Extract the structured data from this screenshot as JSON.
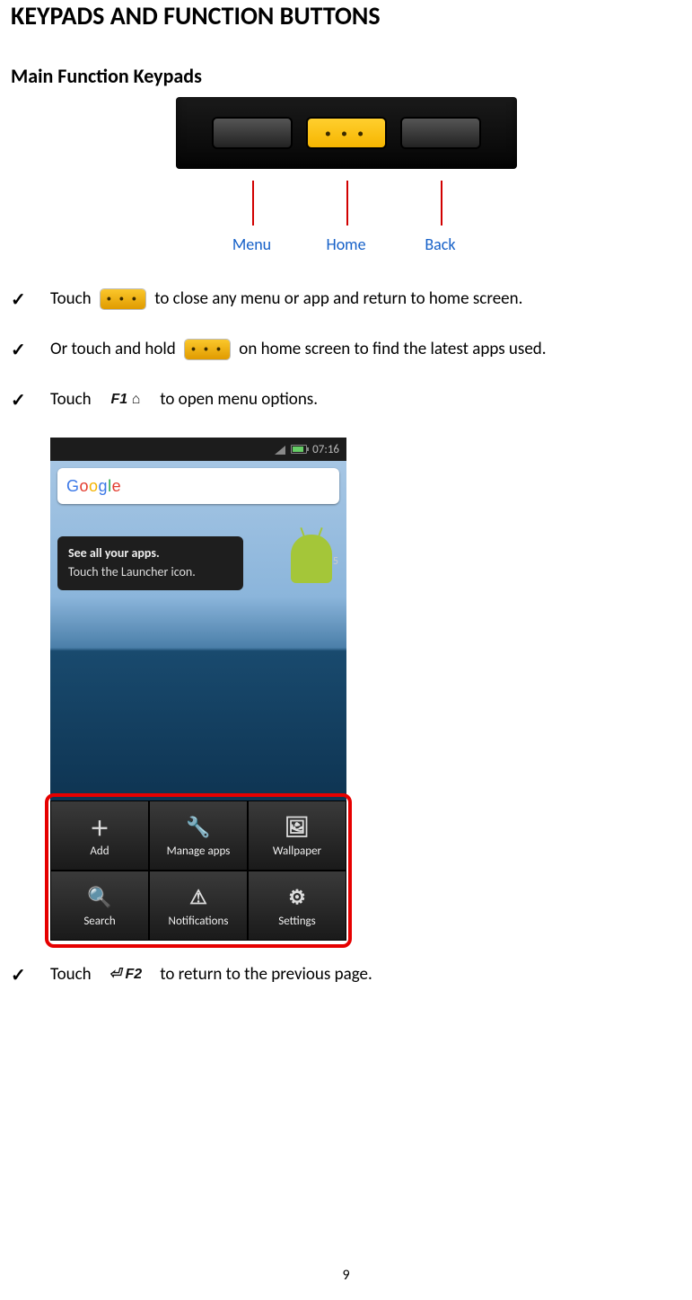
{
  "title_pre": "K",
  "title_mid1": "EYPADS AND ",
  "title_cap2": "F",
  "title_mid2": "UNCTION ",
  "title_cap3": "B",
  "title_mid3": "UTTONS",
  "subtitle": "Main Function Keypads",
  "keypad_labels": {
    "menu": "Menu",
    "home": "Home",
    "back": "Back"
  },
  "bullets": {
    "b1_a": "Touch",
    "b1_b": "to close any menu or app and return to home screen.",
    "b2_a": "Or touch and hold",
    "b2_b": "on home screen to find the latest apps used.",
    "b3_a": "Touch",
    "b3_b": "to open menu options.",
    "b4_a": "Touch",
    "b4_b": "to return to the previous page."
  },
  "f1_label": "F1 ⌂",
  "f2_label": "⏎ F2",
  "screenshot": {
    "time": "07:16",
    "google": {
      "g": "G",
      "o1": "o",
      "o2": "o",
      "g2": "g",
      "l": "l",
      "e": "e"
    },
    "tip_title": "See all your apps.",
    "tip_body": "Touch the Launcher icon.",
    "tip_pages": "1 of 5",
    "menu": {
      "add": "Add",
      "manage": "Manage apps",
      "wallpaper": "Wallpaper",
      "search": "Search",
      "notifications": "Notifications",
      "settings": "Settings"
    },
    "icons": {
      "add": "＋",
      "manage": "🔧",
      "wallpaper": "🖼",
      "search": "🔍",
      "notifications": "⚠",
      "settings": "⚙"
    }
  },
  "page_number": "9"
}
